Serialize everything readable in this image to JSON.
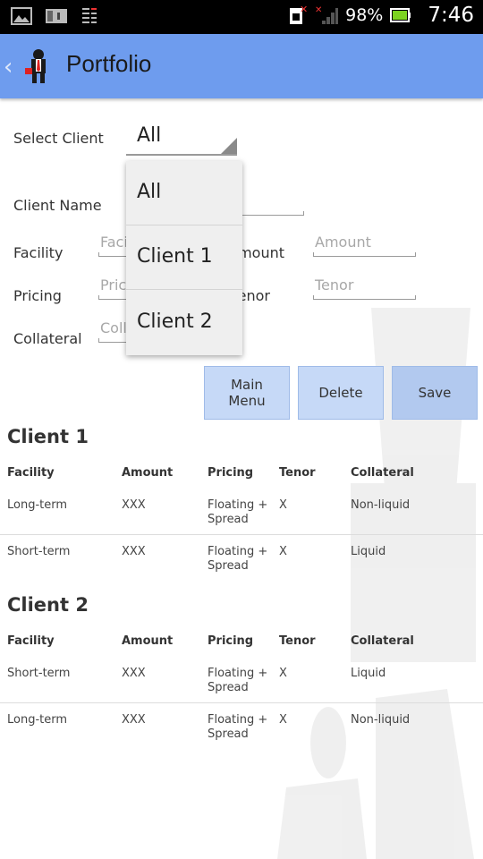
{
  "statusbar": {
    "battery_pct": "98%",
    "time": "7:46",
    "icons": [
      "image-icon",
      "notification-icon",
      "data-sync-icon",
      "sim-no-service-icon",
      "signal-icon",
      "battery-icon"
    ]
  },
  "actionbar": {
    "back_glyph": "‹",
    "title": "Portfolio",
    "color": "#6e9cee"
  },
  "form": {
    "select_client_label": "Select Client",
    "select_client_value": "All",
    "client_name_label": "Client Name",
    "facility_label": "Facility",
    "facility_placeholder": "Facility",
    "amount_label": "Amount",
    "amount_placeholder": "Amount",
    "pricing_label": "Pricing",
    "pricing_placeholder": "Pricing",
    "tenor_label": "Tenor",
    "tenor_placeholder": "Tenor",
    "collateral_label": "Collateral",
    "collateral_placeholder": "Collateral"
  },
  "dropdown": {
    "options": [
      "All",
      "Client 1",
      "Client 2"
    ]
  },
  "buttons": {
    "main_menu": "Main\nMenu",
    "delete": "Delete",
    "save": "Save"
  },
  "columns": [
    "Facility",
    "Amount",
    "Pricing",
    "Tenor",
    "Collateral"
  ],
  "clients": [
    {
      "name": "Client 1",
      "rows": [
        {
          "facility": "Long-term",
          "amount": "XXX",
          "pricing": "Floating +\nSpread",
          "tenor": "X",
          "collateral": "Non-liquid"
        },
        {
          "facility": "Short-term",
          "amount": "XXX",
          "pricing": "Floating +\nSpread",
          "tenor": "X",
          "collateral": "Liquid"
        }
      ]
    },
    {
      "name": "Client 2",
      "rows": [
        {
          "facility": "Short-term",
          "amount": "XXX",
          "pricing": "Floating +\nSpread",
          "tenor": "X",
          "collateral": "Liquid"
        },
        {
          "facility": "Long-term",
          "amount": "XXX",
          "pricing": "Floating +\nSpread",
          "tenor": "X",
          "collateral": "Non-liquid"
        }
      ]
    }
  ]
}
